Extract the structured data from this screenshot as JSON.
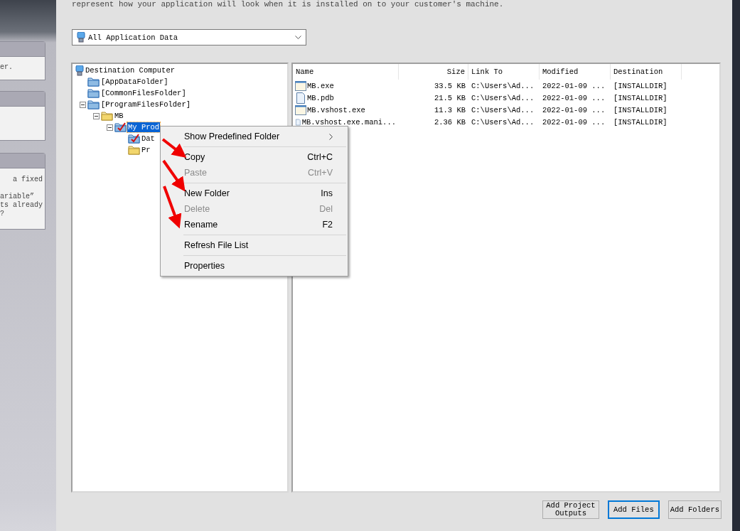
{
  "intro_text": "represent how your application will look when it is installed on to your customer's machine.",
  "side_cards": [
    {
      "kind": "text",
      "paragraphs": [
        [
          "er."
        ]
      ]
    },
    {
      "kind": "blank"
    },
    {
      "kind": "text",
      "paragraphs": [
        [
          "a fixed"
        ],
        [
          "ariable”",
          "ts already",
          "?"
        ]
      ]
    }
  ],
  "view_dropdown": {
    "value": "All Application Data"
  },
  "tree": [
    {
      "label": "Destination Computer",
      "kind": "computer",
      "selected": false,
      "children": [
        {
          "label": "[AppDataFolder]",
          "kind": "system-folder",
          "expanded": false,
          "selected": false
        },
        {
          "label": "[CommonFilesFolder]",
          "kind": "system-folder",
          "expanded": false,
          "selected": false
        },
        {
          "label": "[ProgramFilesFolder]",
          "kind": "system-folder",
          "expanded": true,
          "selected": false,
          "children": [
            {
              "label": "MB",
              "kind": "folder",
              "expanded": true,
              "selected": false,
              "children": [
                {
                  "label": "My Prod",
                  "kind": "checked-folder",
                  "expanded": true,
                  "selected": true,
                  "children": [
                    {
                      "label": "Dat",
                      "kind": "checked-folder",
                      "expanded": false,
                      "selected": false
                    },
                    {
                      "label": "Pr",
                      "kind": "folder",
                      "expanded": false,
                      "selected": false
                    }
                  ]
                }
              ]
            }
          ]
        }
      ]
    }
  ],
  "file_list": {
    "columns": [
      "Name",
      "Size",
      "Link To",
      "Modified",
      "Destination"
    ],
    "rows": [
      {
        "kind": "exe",
        "cells": [
          "MB.exe",
          "33.5 KB",
          "C:\\Users\\Ad...",
          "2022-01-09 ...",
          "[INSTALLDIR]"
        ]
      },
      {
        "kind": "file",
        "cells": [
          "MB.pdb",
          "21.5 KB",
          "C:\\Users\\Ad...",
          "2022-01-09 ...",
          "[INSTALLDIR]"
        ]
      },
      {
        "kind": "exe",
        "cells": [
          "MB.vshost.exe",
          "11.3 KB",
          "C:\\Users\\Ad...",
          "2022-01-09 ...",
          "[INSTALLDIR]"
        ]
      },
      {
        "kind": "file",
        "cells": [
          "MB.vshost.exe.mani...",
          "2.36 KB",
          "C:\\Users\\Ad...",
          "2022-01-09 ...",
          "[INSTALLDIR]"
        ]
      }
    ]
  },
  "context_menu": [
    {
      "kind": "item",
      "label": "Show Predefined Folder",
      "submenu": true,
      "disabled": false
    },
    {
      "kind": "separator"
    },
    {
      "kind": "item",
      "label": "Copy",
      "shortcut": "Ctrl+C",
      "disabled": false
    },
    {
      "kind": "item",
      "label": "Paste",
      "shortcut": "Ctrl+V",
      "disabled": true
    },
    {
      "kind": "separator"
    },
    {
      "kind": "item",
      "label": "New Folder",
      "shortcut": "Ins",
      "disabled": false
    },
    {
      "kind": "item",
      "label": "Delete",
      "shortcut": "Del",
      "disabled": true
    },
    {
      "kind": "item",
      "label": "Rename",
      "shortcut": "F2",
      "disabled": false
    },
    {
      "kind": "separator"
    },
    {
      "kind": "item",
      "label": "Refresh File List",
      "disabled": false
    },
    {
      "kind": "separator"
    },
    {
      "kind": "item",
      "label": "Properties",
      "disabled": false
    }
  ],
  "buttons": [
    {
      "label": "Add Project Outputs",
      "focused": false
    },
    {
      "label": "Add Files",
      "focused": true
    },
    {
      "label": "Add Folders",
      "focused": false
    }
  ]
}
